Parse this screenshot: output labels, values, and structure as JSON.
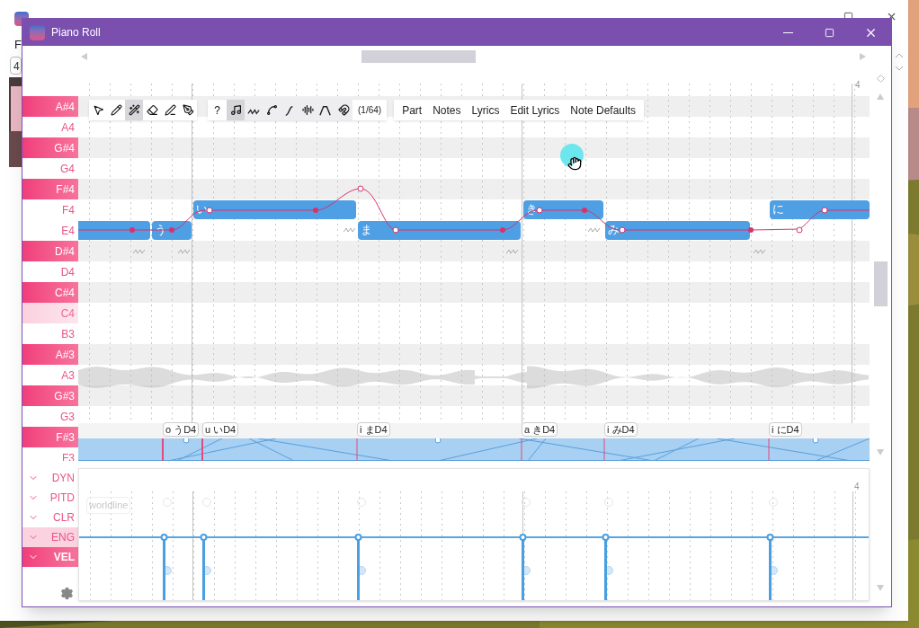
{
  "background_window": {
    "menu_fragment": "F",
    "button_fragment": "4"
  },
  "window": {
    "title": "Piano Roll"
  },
  "keys": [
    {
      "label": "A#4",
      "kind": "black"
    },
    {
      "label": "A4",
      "kind": "white"
    },
    {
      "label": "G#4",
      "kind": "black"
    },
    {
      "label": "G4",
      "kind": "white"
    },
    {
      "label": "F#4",
      "kind": "black"
    },
    {
      "label": "F4",
      "kind": "white"
    },
    {
      "label": "E4",
      "kind": "white"
    },
    {
      "label": "D#4",
      "kind": "black"
    },
    {
      "label": "D4",
      "kind": "white"
    },
    {
      "label": "C#4",
      "kind": "black"
    },
    {
      "label": "C4",
      "kind": "middle"
    },
    {
      "label": "B3",
      "kind": "white"
    },
    {
      "label": "A#3",
      "kind": "black"
    },
    {
      "label": "A3",
      "kind": "white"
    },
    {
      "label": "G#3",
      "kind": "black"
    },
    {
      "label": "G3",
      "kind": "white"
    },
    {
      "label": "F#3",
      "kind": "black"
    },
    {
      "label": "F3",
      "kind": "white"
    }
  ],
  "toolbar": {
    "tools": [
      {
        "selected": false
      },
      {
        "selected": false
      },
      {
        "selected": true
      },
      {
        "selected": false
      },
      {
        "selected": false
      },
      {
        "selected": false
      }
    ],
    "help": "?",
    "toggles": [
      {
        "selected": true
      },
      {
        "selected": false
      },
      {
        "selected": false
      },
      {
        "selected": false
      },
      {
        "selected": false
      },
      {
        "selected": false
      },
      {
        "selected": false
      }
    ],
    "snap": "(1/64)",
    "tabs": [
      "Part",
      "Notes",
      "Lyrics",
      "Edit Lyrics",
      "Note Defaults"
    ]
  },
  "bar_number": "4",
  "notes": [
    {
      "lyric": "う"
    },
    {
      "lyric": "い"
    },
    {
      "lyric": "ま"
    },
    {
      "lyric": "き"
    },
    {
      "lyric": "み"
    },
    {
      "lyric": "に"
    }
  ],
  "phonemes": [
    "o うD4",
    "u いD4",
    "i まD4",
    "a きD4",
    "i みD4",
    "i にD4"
  ],
  "expressions": [
    {
      "label": "DYN",
      "selected": false,
      "highlighted": false
    },
    {
      "label": "PITD",
      "selected": false,
      "highlighted": false
    },
    {
      "label": "CLR",
      "selected": false,
      "highlighted": false
    },
    {
      "label": "ENG",
      "selected": false,
      "highlighted": true
    },
    {
      "label": "VEL",
      "selected": true,
      "highlighted": false
    }
  ],
  "expression_panel": {
    "bar_number": "4",
    "tag": "worldline"
  }
}
